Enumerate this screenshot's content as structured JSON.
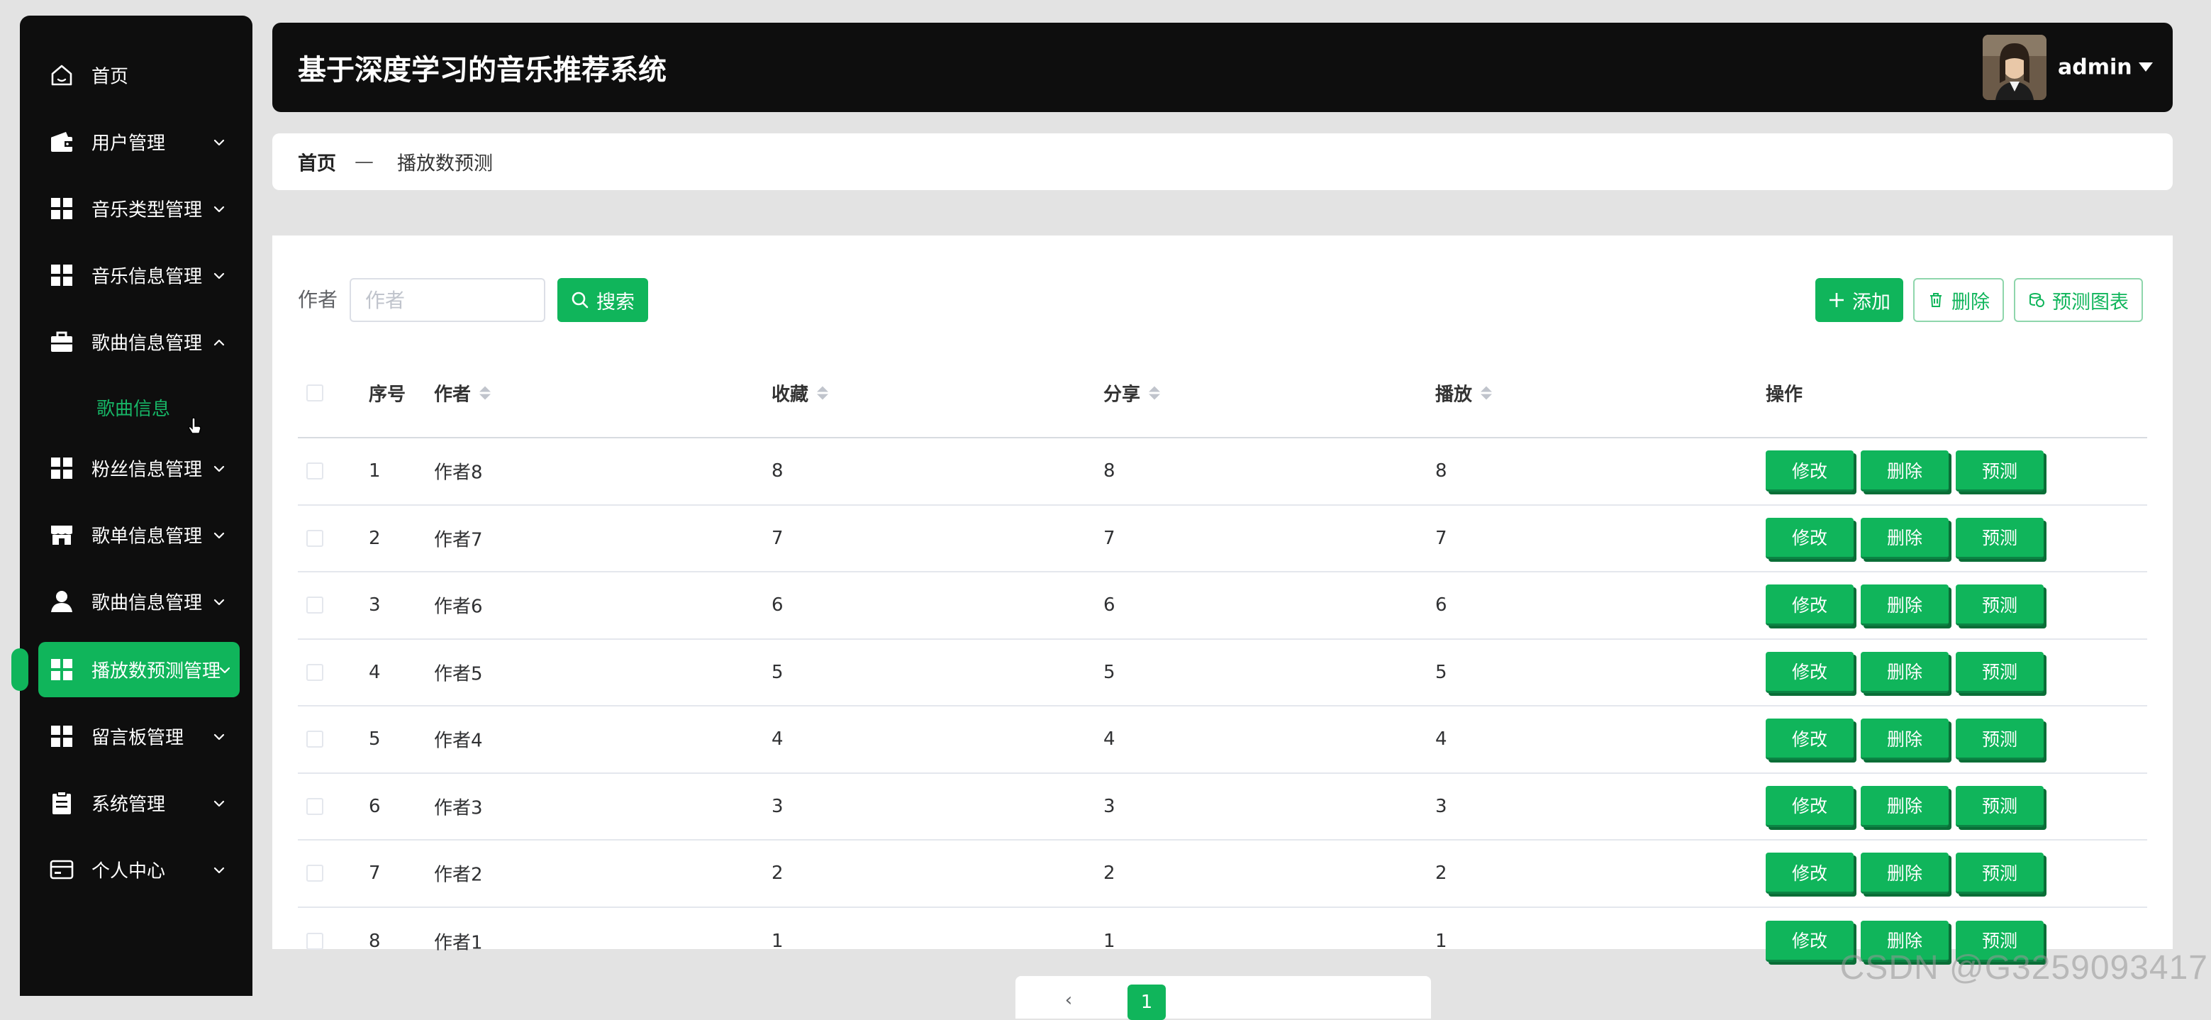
{
  "colors": {
    "accent": "#10b55b",
    "sidebar_bg": "#0e0e0e",
    "header_bg": "#0e0e0e",
    "page_bg": "#e3e3e3"
  },
  "sidebar": {
    "items": [
      {
        "label": "首页",
        "icon": "home-icon",
        "has_chevron": false
      },
      {
        "label": "用户管理",
        "icon": "wallet-icon",
        "has_chevron": true
      },
      {
        "label": "音乐类型管理",
        "icon": "grid-icon",
        "has_chevron": true
      },
      {
        "label": "音乐信息管理",
        "icon": "grid-icon",
        "has_chevron": true
      },
      {
        "label": "歌曲信息管理",
        "icon": "briefcase-icon",
        "has_chevron": true,
        "expanded": true
      },
      {
        "label": "粉丝信息管理",
        "icon": "grid-icon",
        "has_chevron": true
      },
      {
        "label": "歌单信息管理",
        "icon": "shop-icon",
        "has_chevron": true
      },
      {
        "label": "歌曲信息管理",
        "icon": "user-icon",
        "has_chevron": true
      },
      {
        "label": "播放数预测管理",
        "icon": "grid-icon",
        "has_chevron": true,
        "active": true
      },
      {
        "label": "留言板管理",
        "icon": "grid-icon",
        "has_chevron": true
      },
      {
        "label": "系统管理",
        "icon": "clipboard-icon",
        "has_chevron": true
      },
      {
        "label": "个人中心",
        "icon": "card-icon",
        "has_chevron": true
      }
    ],
    "submenu": {
      "label": "歌曲信息"
    }
  },
  "header": {
    "title": "基于深度学习的音乐推荐系统",
    "user": "admin"
  },
  "breadcrumb": {
    "home": "首页",
    "separator": "—",
    "current": "播放数预测"
  },
  "search": {
    "label": "作者",
    "placeholder": "作者",
    "value": "",
    "button": "搜索"
  },
  "toolbar": {
    "add": "添加",
    "delete": "删除",
    "chart": "预测图表"
  },
  "table": {
    "columns": [
      "序号",
      "作者",
      "收藏",
      "分享",
      "播放",
      "操作"
    ],
    "rows": [
      {
        "index": "1",
        "author": "作者8",
        "favorites": "8",
        "shares": "8",
        "plays": "8"
      },
      {
        "index": "2",
        "author": "作者7",
        "favorites": "7",
        "shares": "7",
        "plays": "7"
      },
      {
        "index": "3",
        "author": "作者6",
        "favorites": "6",
        "shares": "6",
        "plays": "6"
      },
      {
        "index": "4",
        "author": "作者5",
        "favorites": "5",
        "shares": "5",
        "plays": "5"
      },
      {
        "index": "5",
        "author": "作者4",
        "favorites": "4",
        "shares": "4",
        "plays": "4"
      },
      {
        "index": "6",
        "author": "作者3",
        "favorites": "3",
        "shares": "3",
        "plays": "3"
      },
      {
        "index": "7",
        "author": "作者2",
        "favorites": "2",
        "shares": "2",
        "plays": "2"
      },
      {
        "index": "8",
        "author": "作者1",
        "favorites": "1",
        "shares": "1",
        "plays": "1"
      }
    ],
    "row_actions": {
      "edit": "修改",
      "delete": "删除",
      "predict": "预测"
    }
  },
  "pagination": {
    "current_page": "1"
  },
  "watermark": "CSDN @G3259093417"
}
